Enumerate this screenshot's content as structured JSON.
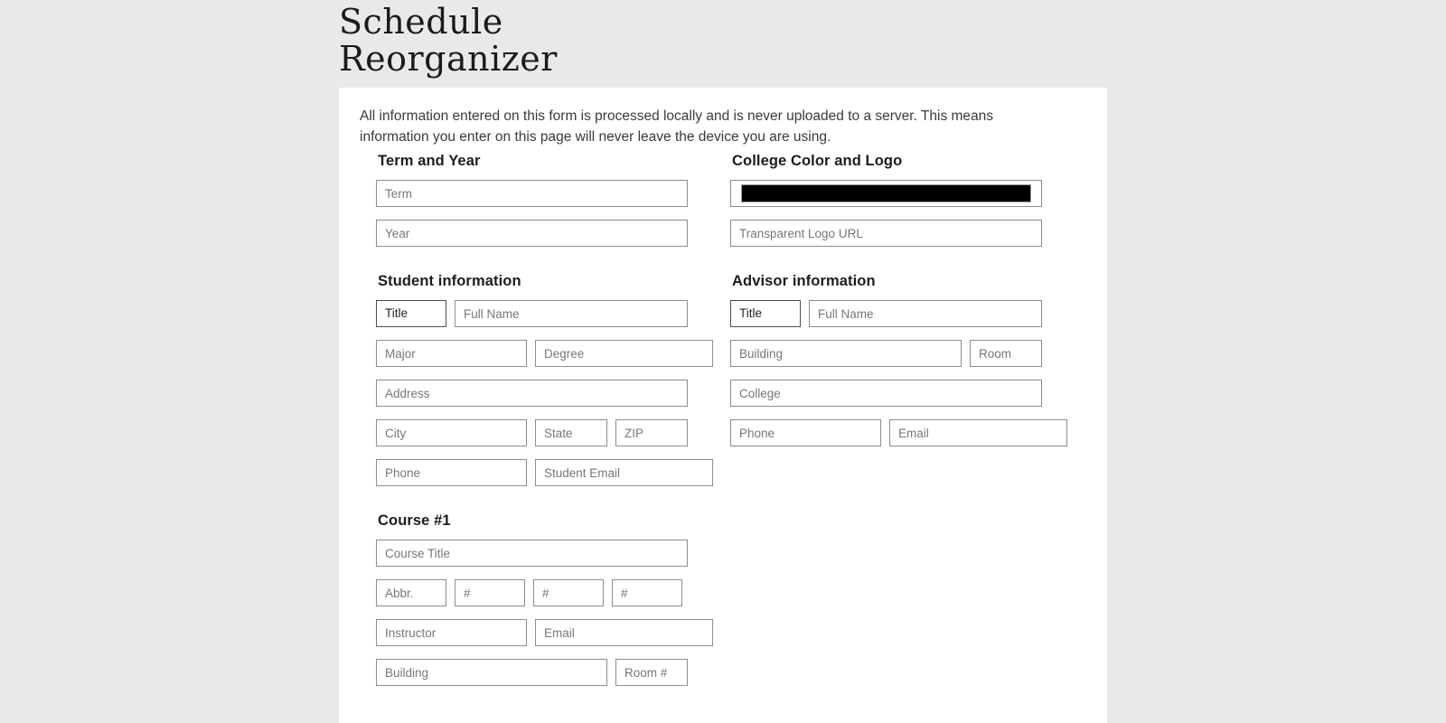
{
  "app": {
    "title": "Schedule\nReorganizer"
  },
  "notice": {
    "text": "All information entered on this form is processed locally and is never uploaded to a server. This means information you enter on this page will never leave the device you are using."
  },
  "sections": {
    "term_year": {
      "heading": "Term and Year",
      "fields": {
        "term": "Term",
        "year": "Year"
      }
    },
    "college_color_logo": {
      "heading": "College Color and Logo",
      "color_value": "#000000",
      "fields": {
        "logo_url": "Transparent Logo URL"
      }
    },
    "student": {
      "heading": "Student information",
      "title_value": "Title",
      "fields": {
        "full_name": "Full Name",
        "major": "Major",
        "degree": "Degree",
        "address": "Address",
        "city": "City",
        "state": "State",
        "zip": "ZIP",
        "phone": "Phone",
        "student_email": "Student Email"
      }
    },
    "advisor": {
      "heading": "Advisor information",
      "title_value": "Title",
      "fields": {
        "full_name": "Full Name",
        "building": "Building",
        "room": "Room",
        "college": "College",
        "phone": "Phone",
        "email": "Email"
      }
    },
    "course": {
      "heading": "Course #1",
      "fields": {
        "course_title": "Course Title",
        "abbr": "Abbr.",
        "num1": "#",
        "num2": "#",
        "num3": "#",
        "instructor": "Instructor",
        "email": "Email",
        "building": "Building",
        "room_num": "Room #"
      }
    }
  },
  "colors": {
    "page_background": "#e9e9e9",
    "card_background": "#ffffff",
    "text": "#1d1d1d",
    "placeholder": "#777777",
    "field_border": "#8d8d8d",
    "select_border": "#4d4d4d",
    "swatch": "#000000"
  }
}
